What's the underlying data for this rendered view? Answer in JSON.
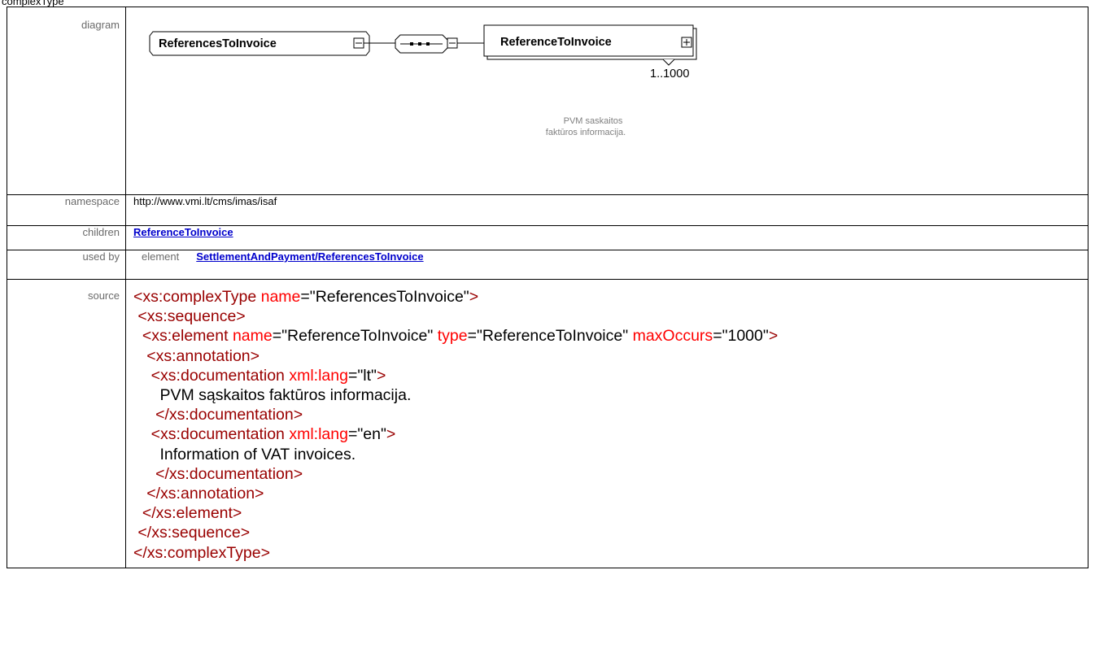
{
  "heading": "complexType",
  "labels": {
    "diagram": "diagram",
    "namespace": "namespace",
    "children": "children",
    "used_by": "used by",
    "source": "source"
  },
  "diagram": {
    "type_name": "ReferencesToInvoice",
    "child_name": "ReferenceToInvoice",
    "occurrence": "1..1000",
    "doc_line1": "PVM saskaitos",
    "doc_line2": "faktūros informacija."
  },
  "namespace": "http://www.vmi.lt/cms/imas/isaf",
  "children": [
    "ReferenceToInvoice"
  ],
  "used_by": {
    "kind": "element",
    "target": "SettlementAndPayment/ReferencesToInvoice"
  },
  "source": {
    "lines": [
      [
        {
          "c": "t",
          "x": "<xs:complexType "
        },
        {
          "c": "a",
          "x": "name"
        },
        {
          "c": "p",
          "x": "=\"ReferencesToInvoice\""
        },
        {
          "c": "t",
          "x": ">"
        }
      ],
      [
        {
          "c": "t",
          "x": " <xs:sequence>"
        }
      ],
      [
        {
          "c": "t",
          "x": "  <xs:element "
        },
        {
          "c": "a",
          "x": "name"
        },
        {
          "c": "p",
          "x": "=\"ReferenceToInvoice\" "
        },
        {
          "c": "a",
          "x": "type"
        },
        {
          "c": "p",
          "x": "=\"ReferenceToInvoice\" "
        },
        {
          "c": "a",
          "x": "maxOccurs"
        },
        {
          "c": "p",
          "x": "=\"1000\""
        },
        {
          "c": "t",
          "x": ">"
        }
      ],
      [
        {
          "c": "t",
          "x": "   <xs:annotation>"
        }
      ],
      [
        {
          "c": "t",
          "x": "    <xs:documentation "
        },
        {
          "c": "a",
          "x": "xml:lang"
        },
        {
          "c": "p",
          "x": "=\"lt\""
        },
        {
          "c": "t",
          "x": ">"
        }
      ],
      [
        {
          "c": "tx",
          "x": "      PVM sąskaitos faktūros informacija."
        }
      ],
      [
        {
          "c": "t",
          "x": "     </xs:documentation>"
        }
      ],
      [
        {
          "c": "t",
          "x": "    <xs:documentation "
        },
        {
          "c": "a",
          "x": "xml:lang"
        },
        {
          "c": "p",
          "x": "=\"en\""
        },
        {
          "c": "t",
          "x": ">"
        }
      ],
      [
        {
          "c": "tx",
          "x": "      Information of VAT invoices."
        }
      ],
      [
        {
          "c": "t",
          "x": "     </xs:documentation>"
        }
      ],
      [
        {
          "c": "t",
          "x": "   </xs:annotation>"
        }
      ],
      [
        {
          "c": "t",
          "x": "  </xs:element>"
        }
      ],
      [
        {
          "c": "t",
          "x": " </xs:sequence>"
        }
      ],
      [
        {
          "c": "t",
          "x": "</xs:complexType>"
        }
      ]
    ]
  }
}
